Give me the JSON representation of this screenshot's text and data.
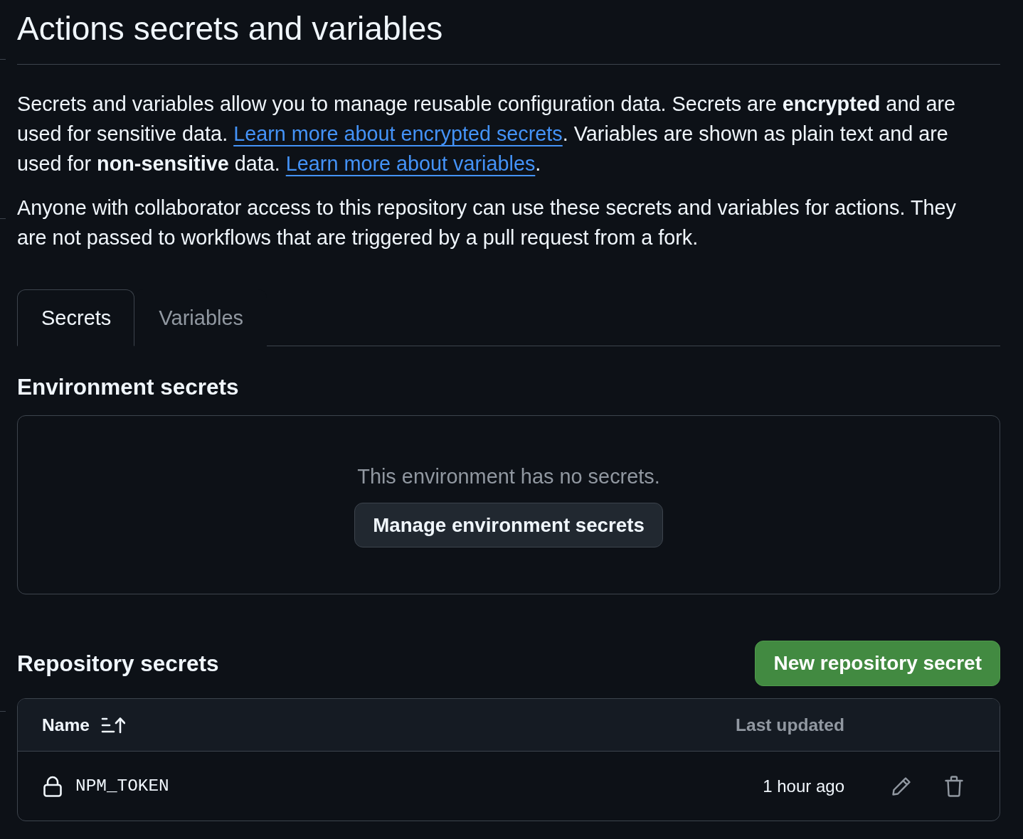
{
  "page": {
    "title": "Actions secrets and variables"
  },
  "intro": [
    {
      "segments": [
        {
          "kind": "text",
          "text": "Secrets and variables allow you to manage reusable configuration data. Secrets are **encrypted** and are used for sensitive data. "
        },
        {
          "kind": "link",
          "text": "Learn more about encrypted secrets"
        },
        {
          "kind": "text",
          "text": ". Variables are shown as plain text and are used for **non-sensitive** data. "
        },
        {
          "kind": "link",
          "text": "Learn more about variables"
        },
        {
          "kind": "text",
          "text": "."
        }
      ]
    },
    {
      "segments": [
        {
          "kind": "text",
          "text": "Anyone with collaborator access to this repository can use these secrets and variables for actions. They are not passed to workflows that are triggered by a pull request from a fork."
        }
      ]
    }
  ],
  "tabs": [
    {
      "label": "Secrets",
      "selected": true
    },
    {
      "label": "Variables",
      "selected": false
    }
  ],
  "environment_secrets": {
    "heading": "Environment secrets",
    "empty_message": "This environment has no secrets.",
    "button": "Manage environment secrets"
  },
  "repository_secrets": {
    "heading": "Repository secrets",
    "new_button": "New repository secret",
    "table": {
      "columns": [
        {
          "label": "Name",
          "sorted": true
        },
        {
          "label": "Last updated",
          "sorted": false
        }
      ],
      "rows": [
        {
          "name": "NPM_TOKEN",
          "updated": "1 hour ago"
        }
      ]
    }
  }
}
